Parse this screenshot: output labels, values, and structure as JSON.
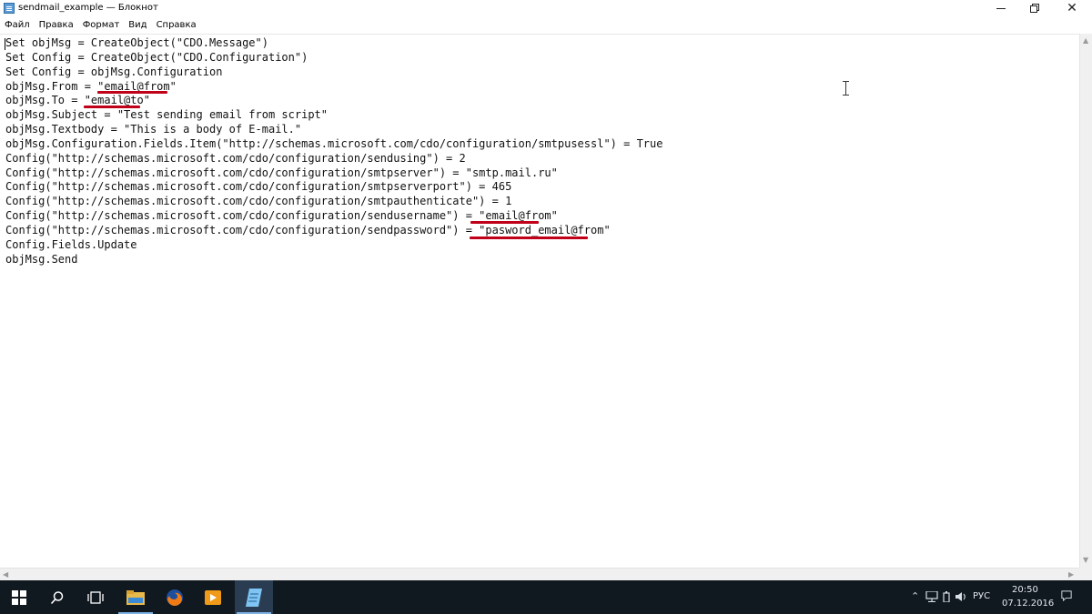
{
  "window": {
    "title": "sendmail_example — Блокнот",
    "close_glyph": "✕"
  },
  "menu": [
    "Файл",
    "Правка",
    "Формат",
    "Вид",
    "Справка"
  ],
  "editor": {
    "lines": [
      "Set objMsg = CreateObject(\"CDO.Message\")",
      "Set Config = CreateObject(\"CDO.Configuration\")",
      "Set Config = objMsg.Configuration",
      "objMsg.From = \"email@from\"",
      "objMsg.To = \"email@to\"",
      "objMsg.Subject = \"Test sending email from script\"",
      "objMsg.Textbody = \"This is a body of E-mail.\"",
      "objMsg.Configuration.Fields.Item(\"http://schemas.microsoft.com/cdo/configuration/smtpusessl\") = True",
      "Config(\"http://schemas.microsoft.com/cdo/configuration/sendusing\") = 2",
      "Config(\"http://schemas.microsoft.com/cdo/configuration/smtpserver\") = \"smtp.mail.ru\"",
      "Config(\"http://schemas.microsoft.com/cdo/configuration/smtpserverport\") = 465",
      "Config(\"http://schemas.microsoft.com/cdo/configuration/smtpauthenticate\") = 1",
      "Config(\"http://schemas.microsoft.com/cdo/configuration/sendusername\") = \"email@from\"",
      "Config(\"http://schemas.microsoft.com/cdo/configuration/sendpassword\") = \"pasword_email@from\"",
      "Config.Fields.Update",
      "objMsg.Send"
    ]
  },
  "taskbar": {
    "tray": {
      "language": "РУС",
      "time": "20:50",
      "date": "07.12.2016"
    }
  },
  "colors": {
    "underline": "#c00018",
    "taskbar": "#101820",
    "accent": "#7fb3e6"
  }
}
